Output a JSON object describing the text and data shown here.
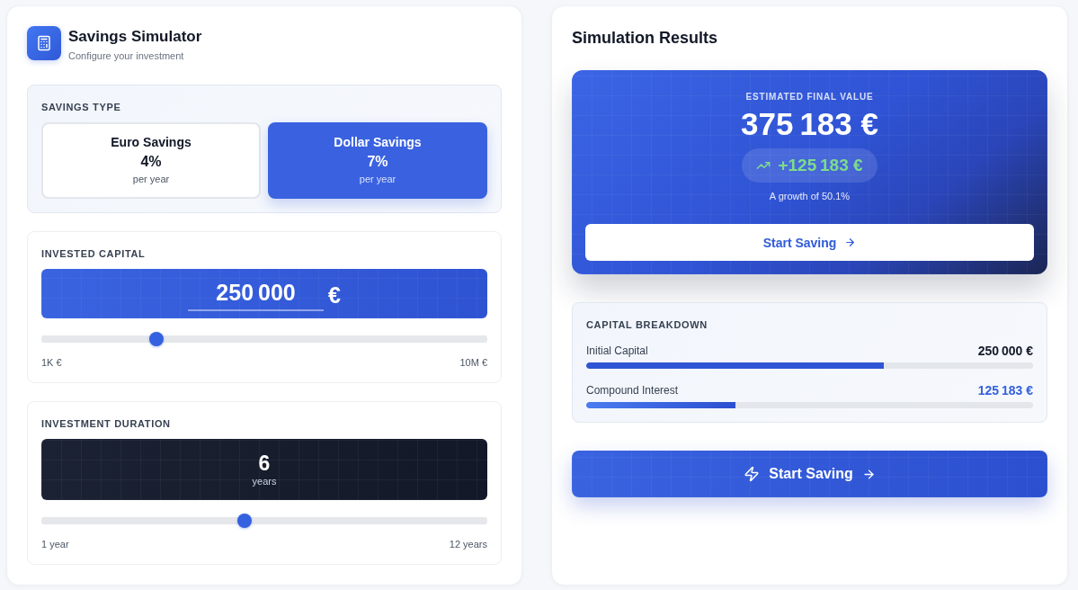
{
  "simulator": {
    "title": "Savings Simulator",
    "subtitle": "Configure your investment"
  },
  "savings_type": {
    "label": "SAVINGS TYPE",
    "options": [
      {
        "name": "Euro Savings",
        "rate": "4%",
        "period": "per year",
        "selected": false
      },
      {
        "name": "Dollar Savings",
        "rate": "7%",
        "period": "per year",
        "selected": true
      }
    ]
  },
  "invested_capital": {
    "label": "INVESTED CAPITAL",
    "value": "250 000",
    "currency": "€",
    "slider": {
      "level": 0.25
    },
    "min_label": "1K €",
    "max_label": "10M €"
  },
  "investment_duration": {
    "label": "INVESTMENT DURATION",
    "value": "6",
    "unit": "years",
    "slider": {
      "level": 0.455
    },
    "min_label": "1 year",
    "max_label": "12 years"
  },
  "results": {
    "title": "Simulation Results",
    "final_value": {
      "label": "ESTIMATED FINAL VALUE",
      "value": "375 183 €",
      "gain": "+125 183 €",
      "growth": "A growth of 50.1%",
      "button": "Start Saving"
    }
  },
  "breakdown": {
    "label": "CAPITAL BREAKDOWN",
    "rows": [
      {
        "kind": "principal",
        "name": "Initial Capital",
        "value": "250 000 €",
        "level": 0.666
      },
      {
        "kind": "interest",
        "name": "Compound Interest",
        "value": "125 183 €",
        "level": 0.334
      }
    ]
  },
  "primary_button": {
    "label": "Start Saving"
  }
}
